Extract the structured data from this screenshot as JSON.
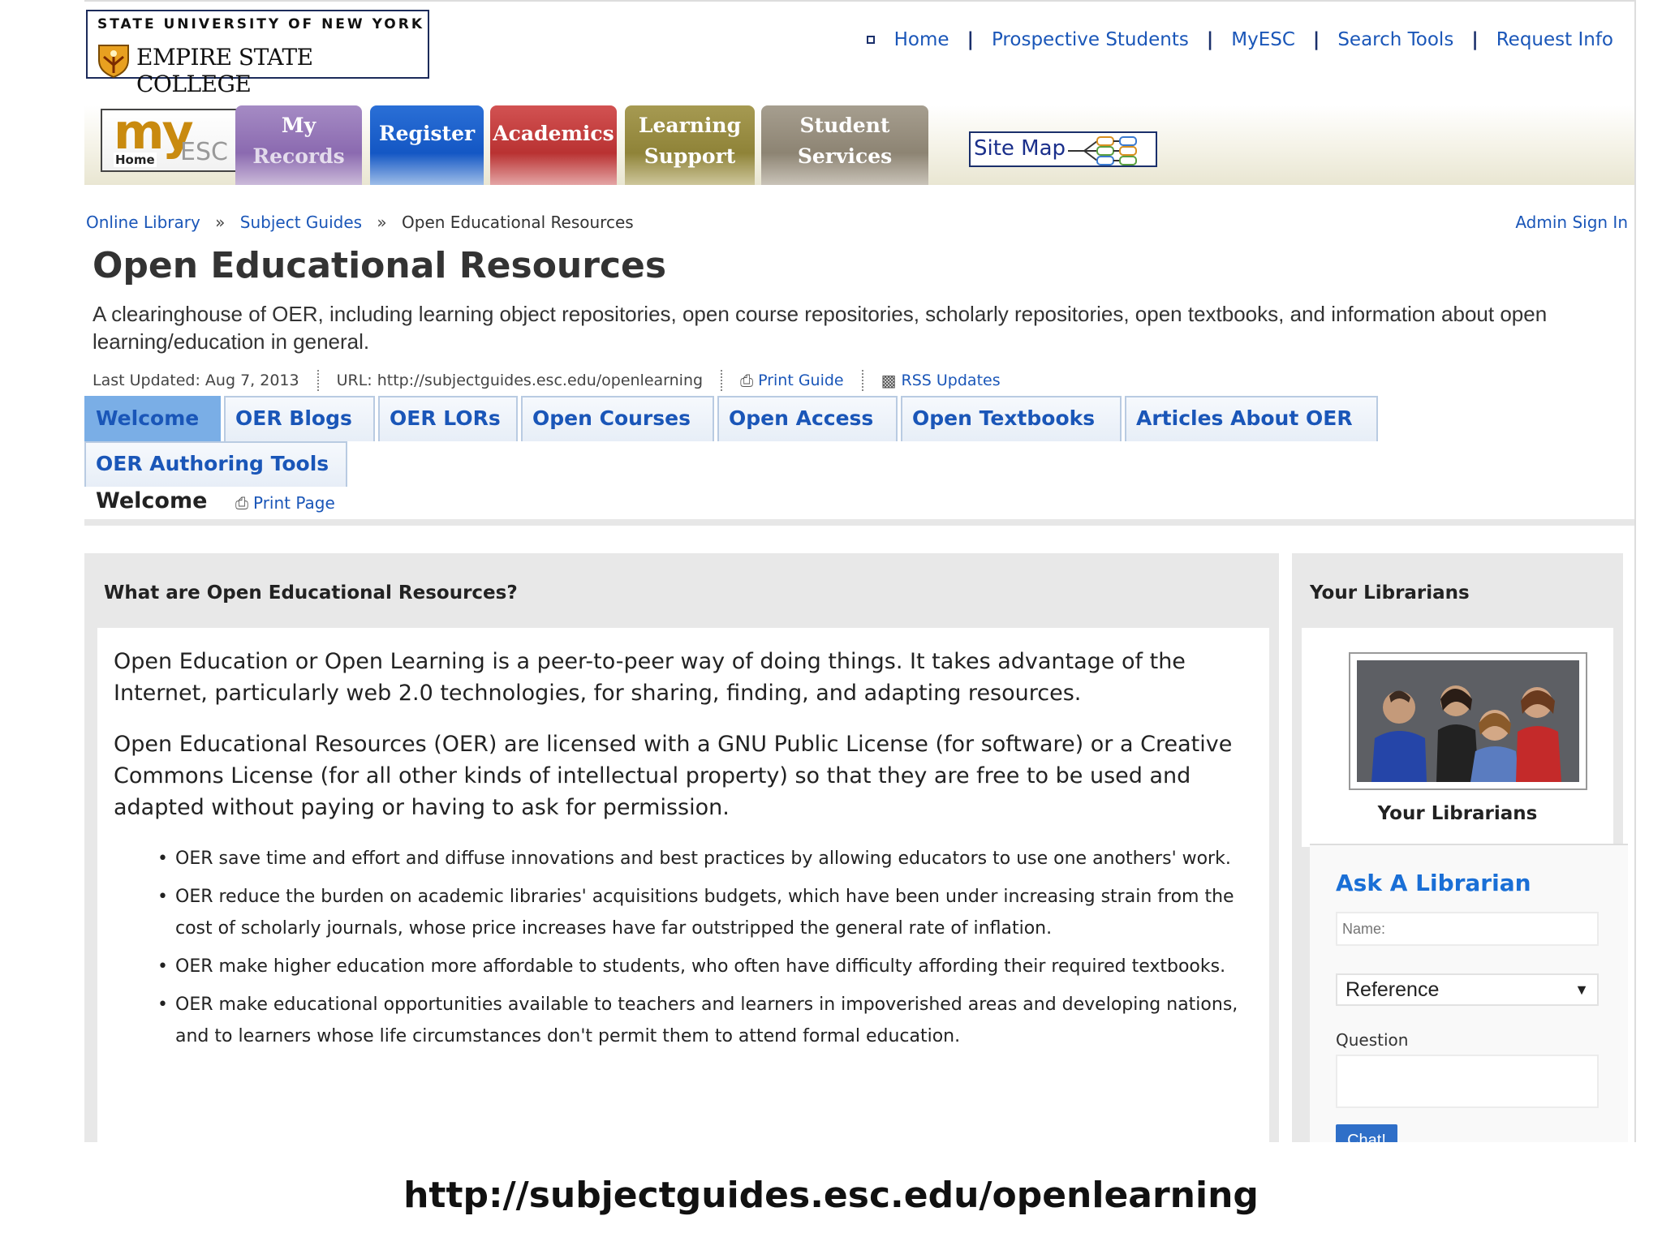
{
  "header": {
    "logo_line1": "STATE UNIVERSITY OF NEW YORK",
    "logo_line2": "EMPIRE STATE COLLEGE",
    "topnav": [
      "Home",
      "Prospective Students",
      "MyESC",
      "Search Tools",
      "Request Info"
    ]
  },
  "tabs": {
    "myesc_my": "my",
    "myesc_esc": "ESC",
    "myesc_home": "Home",
    "my_records_1": "My",
    "my_records_2": "Records",
    "register": "Register",
    "academics": "Academics",
    "learning_1": "Learning",
    "learning_2": "Support",
    "student_1": "Student",
    "student_2": "Services",
    "sitemap": "Site Map"
  },
  "breadcrumb": {
    "items": [
      "Online Library",
      "Subject Guides",
      "Open Educational Resources"
    ],
    "separator": "»",
    "admin": "Admin Sign In"
  },
  "page": {
    "title": "Open Educational Resources",
    "description": "A clearinghouse of OER, including learning object repositories, open course repositories, scholarly repositories, open textbooks, and information about open learning/education in general.",
    "last_updated": "Last Updated: Aug 7, 2013",
    "url": "URL: http://subjectguides.esc.edu/openlearning",
    "print_guide": "Print Guide",
    "rss": "RSS Updates"
  },
  "guide_tabs": [
    "Welcome",
    "OER Blogs",
    "OER LORs",
    "Open Courses",
    "Open Access",
    "Open Textbooks",
    "Articles About OER",
    "OER Authoring Tools"
  ],
  "subbar": {
    "current": "Welcome",
    "print_page": "Print Page"
  },
  "main": {
    "heading": "What are Open Educational Resources?",
    "para1": "Open Education or Open Learning is a peer-to-peer way of doing things. It takes advantage of the Internet, particularly web 2.0 technologies, for sharing, finding, and adapting resources.",
    "para2": "Open Educational Resources (OER) are licensed with a GNU Public License (for software) or a Creative Commons License (for all other kinds of intellectual property) so that they are free to be used and adapted without paying or having to ask for permission.",
    "bullets": [
      "OER save time and effort and diffuse innovations and best practices by allowing educators to use one anothers' work.",
      "OER reduce the burden on academic libraries' acquisitions budgets, which have been under increasing strain from the cost of scholarly journals, whose price increases have far outstripped the general rate of inflation.",
      "OER make higher education more affordable to students, who often have difficulty affording their required textbooks.",
      "OER make educational opportunities available to teachers and learners in impoverished areas and developing nations, and to learners whose life circumstances don't permit them to attend formal education."
    ]
  },
  "side": {
    "heading": "Your Librarians",
    "caption": "Your Librarians",
    "ask_heading": "Ask A Librarian",
    "name_placeholder": "Name:",
    "select_value": "Reference",
    "question_label": "Question",
    "chat_button": "Chat!"
  },
  "footer_caption": "http://subjectguides.esc.edu/openlearning",
  "colors": {
    "link": "#1a56b8",
    "active_tab": "#7aaee6",
    "panel_bg": "#e8e8e8",
    "ask_heading": "#1a6fd6"
  }
}
